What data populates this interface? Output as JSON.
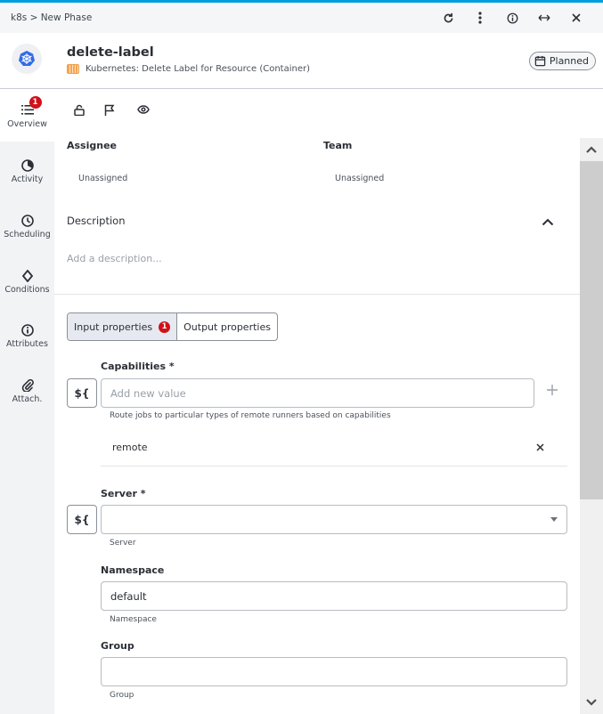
{
  "titlebar": {
    "breadcrumb": "k8s > New Phase",
    "icons": [
      "refresh-icon",
      "more-vertical-icon",
      "info-icon",
      "expand-horizontal-icon",
      "close-icon"
    ]
  },
  "header": {
    "title": "delete-label",
    "subtitle": "Kubernetes: Delete Label for Resource (Container)",
    "status": "Planned",
    "accent_color": "#009fdb",
    "logo_color": "#326ce5"
  },
  "sidebar": {
    "items": [
      {
        "label": "Overview",
        "icon": "list-icon",
        "badge": "1",
        "active": true
      },
      {
        "label": "Activity",
        "icon": "activity-icon"
      },
      {
        "label": "Scheduling",
        "icon": "clock-icon"
      },
      {
        "label": "Conditions",
        "icon": "diamond-icon"
      },
      {
        "label": "Attributes",
        "icon": "info-icon"
      },
      {
        "label": "Attach.",
        "icon": "paperclip-icon"
      }
    ]
  },
  "main": {
    "toolbar_icons": [
      "lock-open-icon",
      "flag-icon",
      "eye-icon"
    ],
    "assignee_label": "Assignee",
    "assignee_value": "Unassigned",
    "team_label": "Team",
    "team_value": "Unassigned",
    "description_label": "Description",
    "description_placeholder": "Add a description...",
    "tabs": [
      {
        "label": "Input properties",
        "badge": "1",
        "active": true
      },
      {
        "label": "Output properties"
      }
    ],
    "expression_button": "${",
    "fields": {
      "capabilities": {
        "label": "Capabilities *",
        "placeholder": "Add new value",
        "hint": "Route jobs to particular types of remote runners based on capabilities",
        "values": [
          "remote"
        ]
      },
      "server": {
        "label": "Server *",
        "value": "",
        "hint": "Server"
      },
      "namespace": {
        "label": "Namespace",
        "value": "default",
        "hint": "Namespace"
      },
      "group": {
        "label": "Group",
        "value": "",
        "hint": "Group"
      }
    }
  }
}
